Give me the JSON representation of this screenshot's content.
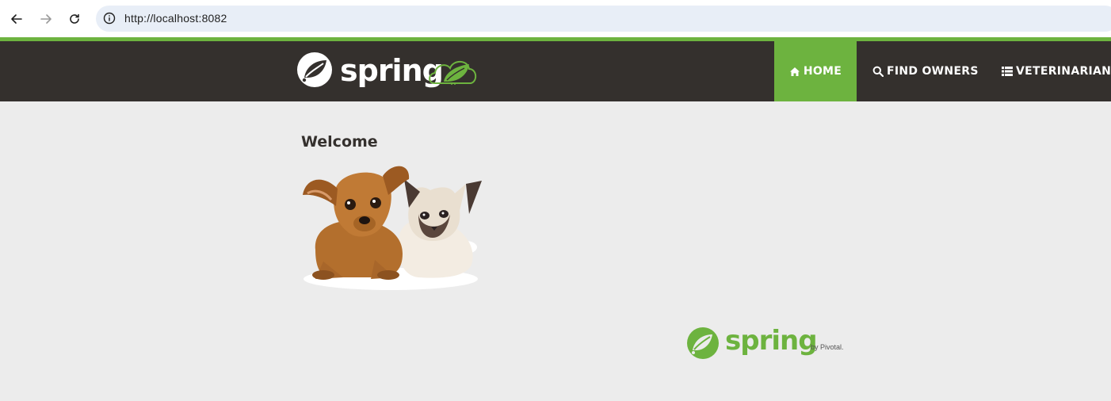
{
  "browser": {
    "url": "http://localhost:8082"
  },
  "navbar": {
    "brand_text": "spring",
    "items": [
      {
        "label": "HOME",
        "icon": "home-icon",
        "active": true
      },
      {
        "label": "FIND OWNERS",
        "icon": "search-icon",
        "active": false
      },
      {
        "label": "VETERINARIANS",
        "icon": "list-icon",
        "active": false
      }
    ]
  },
  "main": {
    "heading": "Welcome"
  },
  "footer": {
    "brand_text": "spring",
    "by_text": "by Pivotal."
  },
  "colors": {
    "accent_green": "#6db33f",
    "navbar_dark": "#34302d",
    "page_bg": "#ececec"
  }
}
